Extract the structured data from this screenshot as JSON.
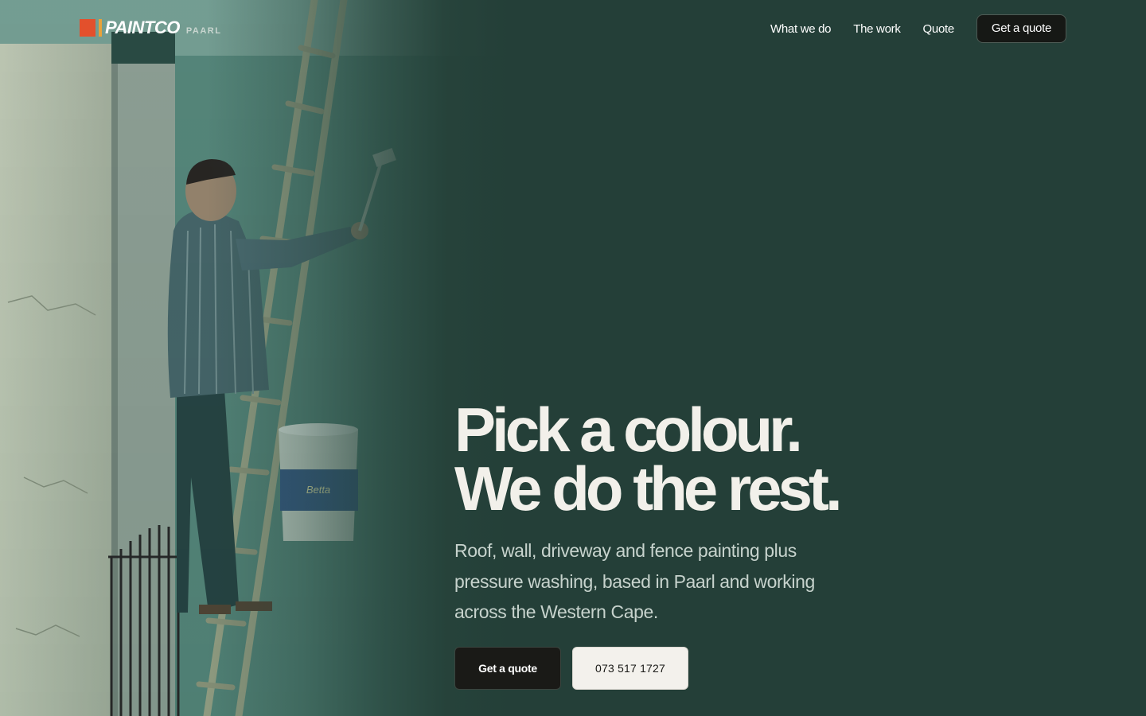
{
  "brand": {
    "name": "PAINTCO",
    "city": "PAARL",
    "colors": {
      "mark_primary": "#e3502c",
      "mark_secondary": "#e8a23a"
    }
  },
  "nav": {
    "links": [
      {
        "label": "What we do"
      },
      {
        "label": "The work"
      },
      {
        "label": "Quote"
      }
    ],
    "cta_label": "Get a quote"
  },
  "hero": {
    "headline_line1": "Pick a colour.",
    "headline_line2": "We do the rest.",
    "description": "Roof, wall, driveway and fence painting plus pressure washing, based in Paarl and working across the Western Cape.",
    "primary_cta": "Get a quote",
    "secondary_cta": "073 517 1727",
    "image_label": "Betta"
  },
  "theme": {
    "background": "#243f38",
    "headline_color": "#f2f0ea",
    "button_dark": "#1a1a17",
    "button_light": "#f3f1ec"
  }
}
